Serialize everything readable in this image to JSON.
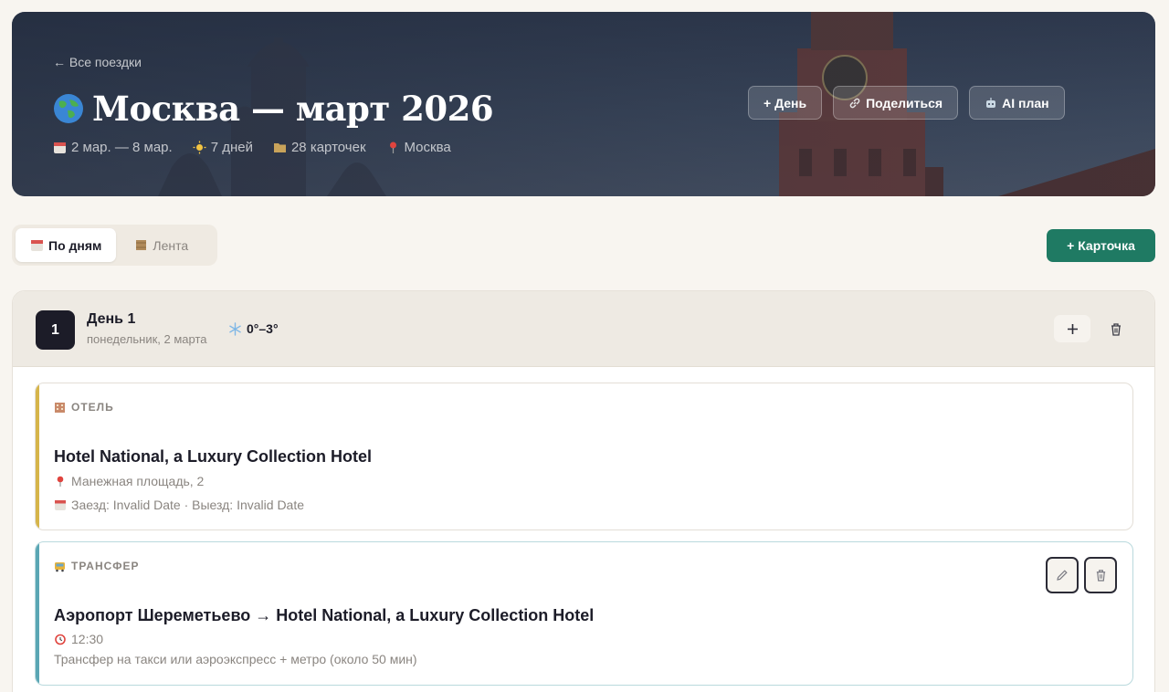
{
  "header": {
    "back_link": "← Все поездки",
    "title": "Москва — март 2026",
    "meta": {
      "dates": "2 мар. — 8 мар.",
      "days": "7 дней",
      "cards": "28 карточек",
      "city": "Москва"
    },
    "actions": {
      "add_day": "+ День",
      "share": "Поделиться",
      "ai_plan": "AI план"
    }
  },
  "toolbar": {
    "tab_days": "По дням",
    "tab_feed": "Лента",
    "add_card": "+ Карточка"
  },
  "day": {
    "number": "1",
    "title": "День 1",
    "subtitle": "понедельник, 2 марта",
    "weather": "0°–3°"
  },
  "cards": [
    {
      "type": "ОТЕЛЬ",
      "title": "Hotel National, a Luxury Collection Hotel",
      "address": "Манежная площадь, 2",
      "dates": "Заезд: Invalid Date · Выезд: Invalid Date"
    },
    {
      "type": "ТРАНСФЕР",
      "title": "Аэропорт Шереметьево → Hotel National, a Luxury Collection Hotel",
      "time": "12:30",
      "note": "Трансфер на такси или аэроэкспресс + метро (около 50 мин)"
    }
  ],
  "colors": {
    "primary": "#1f7a63",
    "dark": "#1c1c28",
    "hotel_accent": "#d6b54a",
    "transfer_accent": "#5aa6b4",
    "background": "#f8f5f0"
  },
  "icons": {
    "globe": "globe-icon",
    "calendar": "calendar-icon",
    "sun": "sun-icon",
    "folder": "folder-icon",
    "pin": "pin-icon",
    "link": "link-icon",
    "robot": "robot-icon",
    "snowflake": "snowflake-icon",
    "hotel": "hotel-icon",
    "bus": "bus-icon",
    "alarm": "alarm-clock-icon",
    "pencil": "pencil-icon",
    "trash": "trash-icon"
  }
}
